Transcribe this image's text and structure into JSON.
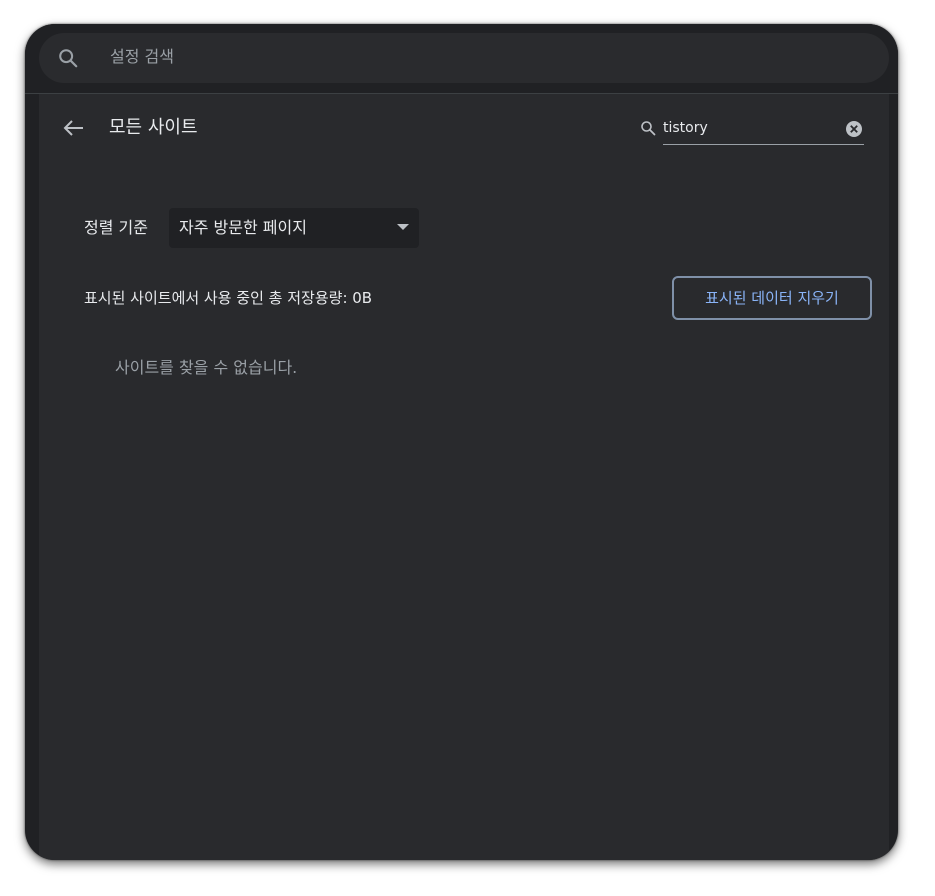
{
  "topbar": {
    "search_placeholder": "설정 검색",
    "search_icon": "search-icon"
  },
  "header": {
    "back_icon": "arrow-left-icon",
    "title": "모든 사이트",
    "site_search": {
      "icon": "search-icon",
      "value": "tistory",
      "clear_icon": "clear-circle-icon"
    }
  },
  "sort": {
    "label": "정렬 기준",
    "selected": "자주 방문한 페이지"
  },
  "storage": {
    "text": "표시된 사이트에서 사용 중인 총 저장용량: 0B",
    "clear_button_label": "표시된 데이터 지우기"
  },
  "empty": {
    "message": "사이트를 찾을 수 없습니다."
  },
  "colors": {
    "background": "#202124",
    "panel": "#292a2d",
    "accent": "#8ab4f8",
    "text_primary": "#e8eaed",
    "text_secondary": "#9aa0a6"
  }
}
